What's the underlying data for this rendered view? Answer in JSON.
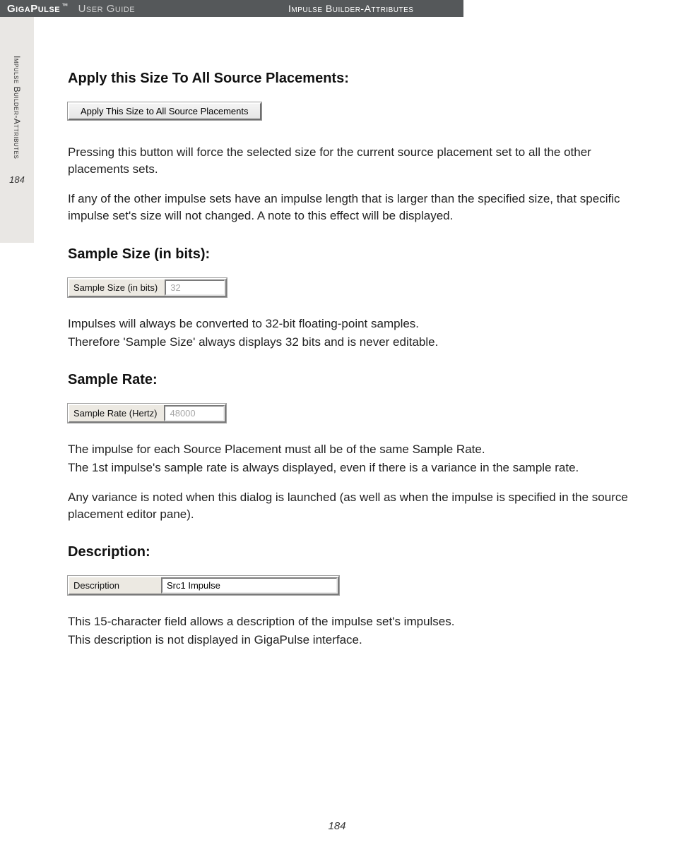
{
  "header": {
    "brand": "GigaPulse",
    "tm": "™",
    "guide": "User Guide",
    "breadcrumb": "Impulse Builder-Attributes"
  },
  "sidebar": {
    "section": "Impulse Builder-Attributes",
    "page": "184"
  },
  "sections": {
    "apply": {
      "heading": "Apply this Size To All Source Placements:",
      "button_label": "Apply This Size to All Source Placements",
      "para1": "Pressing this button will force the selected size for the current source placement set to all the other placements sets.",
      "para2": "If any of the other impulse sets have an impulse length that is larger than the specified size, that specific impulse set's size will not changed.  A note to this effect will be displayed."
    },
    "sample_size": {
      "heading": "Sample Size (in bits):",
      "label": "Sample Size (in bits)",
      "value": "32",
      "para1": "Impulses will always be converted to 32-bit floating-point samples.",
      "para2": "Therefore 'Sample Size' always displays 32 bits and is never editable."
    },
    "sample_rate": {
      "heading": "Sample Rate:",
      "label": "Sample Rate (Hertz)",
      "value": "48000",
      "para1": "The impulse for each Source Placement must all be of the same Sample Rate.",
      "para2": "The 1st impulse's sample rate is always displayed, even if there is a variance in the sample rate.",
      "para3": "Any variance is noted when this dialog is launched (as well as when the impulse is specified in the source placement editor pane)."
    },
    "description": {
      "heading": "Description:",
      "label": "Description",
      "value": "Src1 Impulse",
      "para1": "This 15-character field allows a description of the impulse set's impulses.",
      "para2": "This description is not displayed in GigaPulse interface."
    }
  },
  "footer": {
    "page": "184"
  }
}
